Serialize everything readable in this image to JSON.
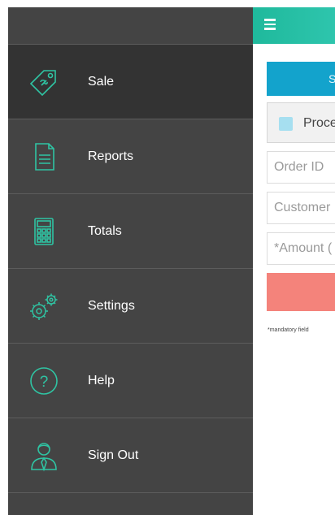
{
  "menu": {
    "items": [
      {
        "label": "Sale",
        "icon": "sale-tag-icon",
        "active": true
      },
      {
        "label": "Reports",
        "icon": "reports-icon",
        "active": false
      },
      {
        "label": "Totals",
        "icon": "calculator-icon",
        "active": false
      },
      {
        "label": "Settings",
        "icon": "gears-icon",
        "active": false
      },
      {
        "label": "Help",
        "icon": "help-icon",
        "active": false
      },
      {
        "label": "Sign Out",
        "icon": "user-sign-out-icon",
        "active": false
      }
    ]
  },
  "main": {
    "primary_button_label": "S",
    "checkbox_label": "Proce",
    "order_id_placeholder": "Order ID",
    "customer_placeholder": "Customer",
    "amount_placeholder": "*Amount (",
    "mandatory_note": "*mandatory field"
  },
  "colors": {
    "accent": "#1fb99c",
    "drawer_bg": "#444444",
    "drawer_active": "#333333",
    "primary_button": "#13a3cc",
    "submit_button": "#f4837b",
    "icon_stroke": "#2fc4a3"
  }
}
